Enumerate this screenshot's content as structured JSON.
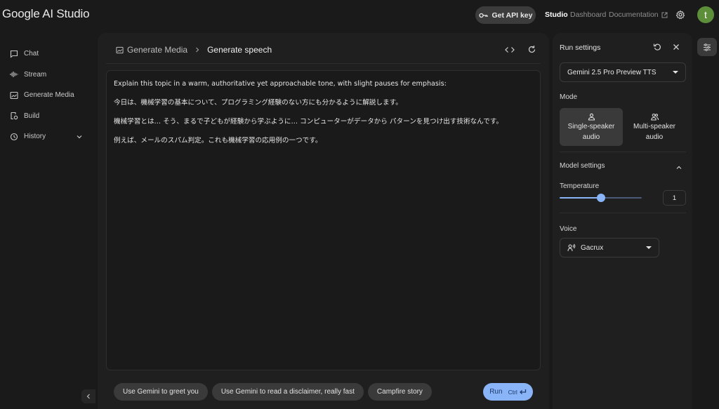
{
  "header": {
    "logo": "Google AI Studio",
    "api_key_label": "Get API key",
    "nav": {
      "studio": "Studio",
      "dashboard": "Dashboard",
      "documentation": "Documentation"
    },
    "avatar_initial": "t"
  },
  "sidebar": {
    "items": [
      {
        "label": "Chat",
        "icon": "chat-icon"
      },
      {
        "label": "Stream",
        "icon": "stream-icon"
      },
      {
        "label": "Generate Media",
        "icon": "media-icon"
      },
      {
        "label": "Build",
        "icon": "build-icon"
      },
      {
        "label": "History",
        "icon": "history-icon"
      }
    ]
  },
  "main": {
    "breadcrumb": {
      "parent": "Generate Media",
      "current": "Generate speech"
    },
    "prompt_lines": [
      "Explain this topic in a warm, authoritative yet approachable tone, with slight pauses for emphasis:",
      "今日は、機械学習の基本について、プログラミング経験のない方にも分かるように解説します。",
      "機械学習とは… そう、まるで子どもが経験から学ぶように… コンピューターがデータから パターンを見つけ出す技術なんです。",
      "例えば、メールのスパム判定。これも機械学習の応用例の一つです。"
    ],
    "suggestions": [
      "Use Gemini to greet you",
      "Use Gemini to read a disclaimer, really fast",
      "Campfire story"
    ],
    "run_label": "Run",
    "run_shortcut": "Ctrl"
  },
  "settings": {
    "title": "Run settings",
    "model": "Gemini 2.5 Pro Preview TTS",
    "mode_label": "Mode",
    "modes": [
      {
        "line1": "Single-speaker",
        "line2": "audio",
        "active": true
      },
      {
        "line1": "Multi-speaker",
        "line2": "audio",
        "active": false
      }
    ],
    "model_settings_label": "Model settings",
    "temperature_label": "Temperature",
    "temperature_value": "1",
    "temperature_fraction": 0.5,
    "voice_label": "Voice",
    "voice": "Gacrux"
  }
}
